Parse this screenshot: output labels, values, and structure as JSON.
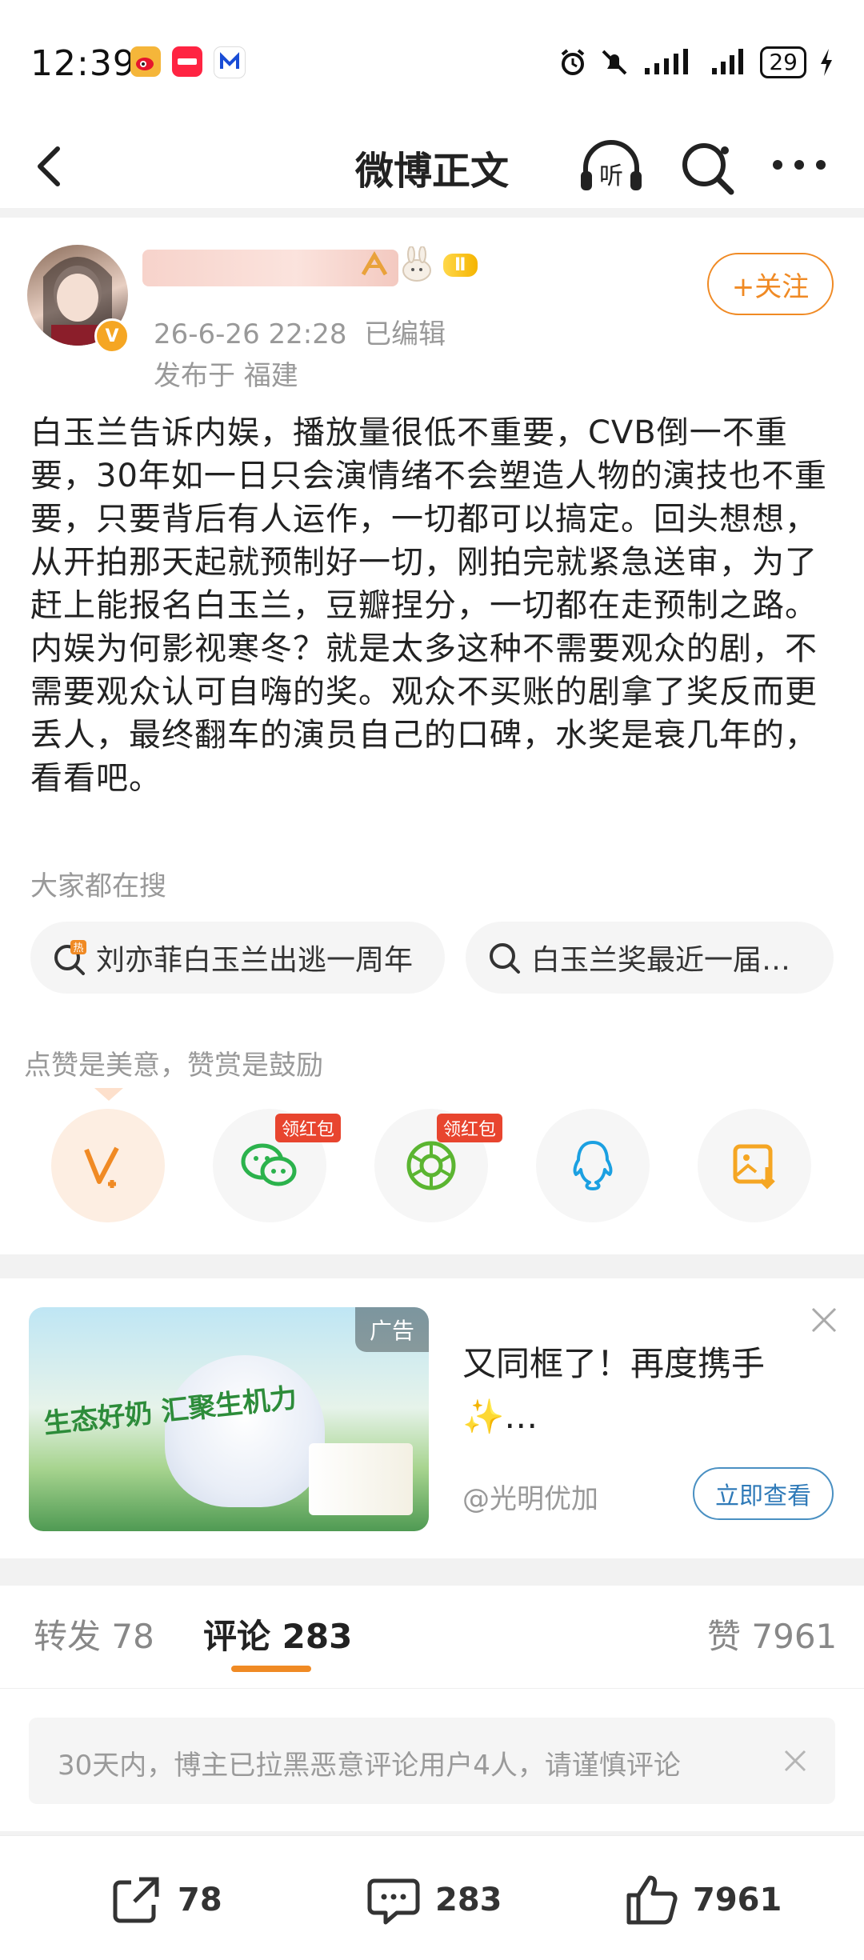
{
  "status_bar": {
    "time": "12:39",
    "apps": [
      "weibo-app-icon",
      "xiaohongshu-app-icon",
      "mango-app-icon"
    ],
    "battery": "29"
  },
  "nav": {
    "title": "微博正文"
  },
  "post": {
    "user_level": "Ⅱ",
    "timestamp": "26-6-26 22:28",
    "edited": "已编辑",
    "location": "发布于 福建",
    "follow_label": "+关注",
    "text": "白玉兰告诉内娱，播放量很低不重要，CVB倒一不重要，30年如一日只会演情绪不会塑造人物的演技也不重要，只要背后有人运作，一切都可以搞定。回头想想，从开拍那天起就预制好一切，刚拍完就紧急送审，为了赶上能报名白玉兰，豆瓣捏分，一切都在走预制之路。内娱为何影视寒冬？就是太多这种不需要观众的剧，不需要观众认可自嗨的奖。观众不买账的剧拿了奖反而更丢人，最终翻车的演员自己的口碑，水奖是衰几年的，看看吧。"
  },
  "hot_search": {
    "label": "大家都在搜",
    "items": [
      {
        "text": "刘亦菲白玉兰出逃一周年",
        "icon": "hot-search-icon"
      },
      {
        "text": "白玉兰奖最近一届…",
        "icon": "search-icon"
      }
    ]
  },
  "share": {
    "tip": "点赞是美意，赞赏是鼓励",
    "redpack_label": "领红包",
    "items": [
      {
        "name": "reward-vip-icon"
      },
      {
        "name": "wechat-icon",
        "redpack": true
      },
      {
        "name": "moments-icon",
        "redpack": true
      },
      {
        "name": "qq-icon"
      },
      {
        "name": "save-image-icon"
      }
    ]
  },
  "ad": {
    "tag": "广告",
    "image_slogan": "生态好奶 汇聚生机力",
    "title": "又同框了！再度携手✨…",
    "source": "@光明优加",
    "button": "立即查看"
  },
  "tabs": {
    "repost_label": "转发",
    "repost_count": "78",
    "comment_label": "评论",
    "comment_count": "283",
    "like_label": "赞",
    "like_count": "7961"
  },
  "notice": {
    "text": "30天内，博主已拉黑恶意评论用户4人，请谨慎评论"
  },
  "bottom_bar": {
    "repost": "78",
    "comment": "283",
    "like": "7961"
  },
  "colors": {
    "accent_orange": "#f08a24",
    "link_blue": "#2f7ab8",
    "red_badge": "#e8452f"
  }
}
